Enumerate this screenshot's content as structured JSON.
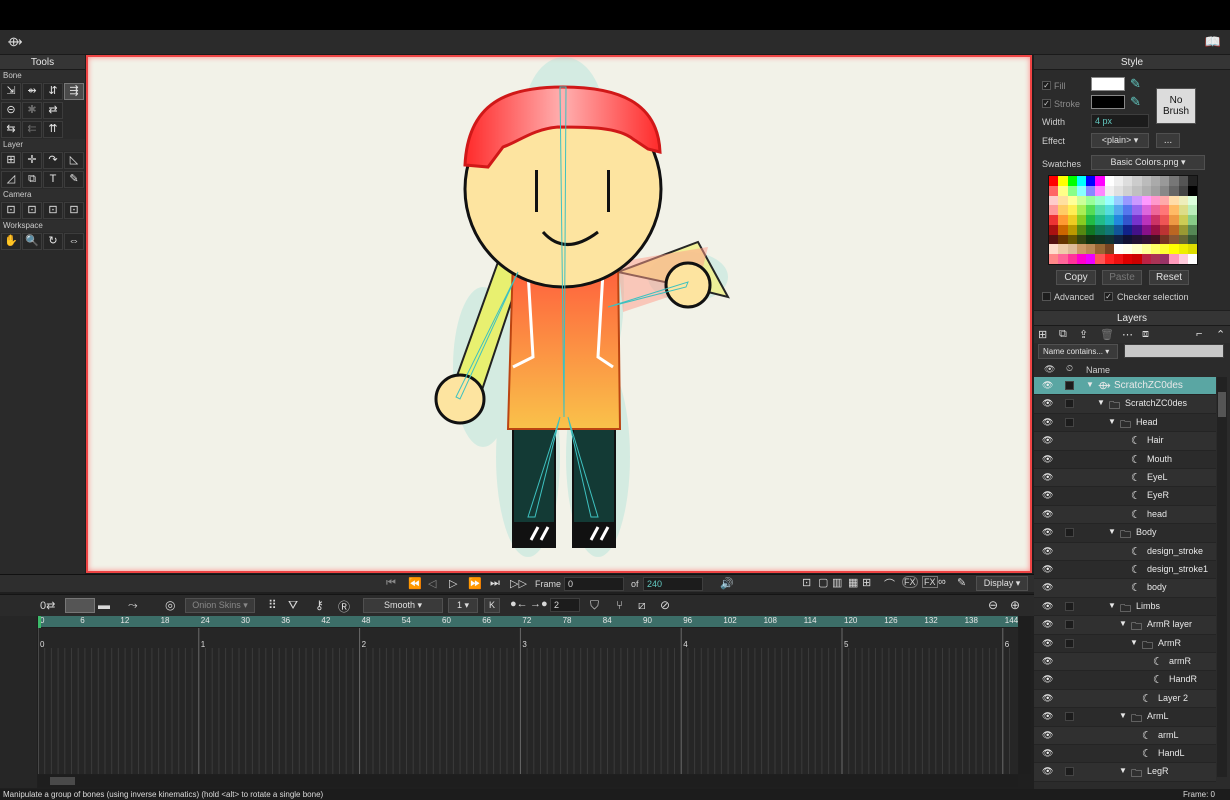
{
  "menubar": {
    "left_icon": "bone-tool-icon",
    "right_icon": "book-icon"
  },
  "tools": {
    "title": "Tools",
    "sections": [
      {
        "label": "Bone",
        "rows": [
          [
            "⇲",
            "⇴",
            "⇵",
            "⇶"
          ],
          [
            "⊝",
            "✱",
            "⇄"
          ],
          [
            "⇆",
            "⇇",
            "⇈"
          ]
        ]
      },
      {
        "label": "Layer",
        "rows": [
          [
            "⊞",
            "✛",
            "↷",
            "◺"
          ],
          [
            "◿",
            "⧉",
            "T",
            "✎"
          ]
        ]
      },
      {
        "label": "Camera",
        "rows": [
          [
            "⊡",
            "⊡",
            "⊡",
            "⊡"
          ]
        ]
      },
      {
        "label": "Workspace",
        "rows": [
          [
            "✋",
            "🔍",
            "↻",
            "⇔"
          ]
        ]
      }
    ]
  },
  "style": {
    "title": "Style",
    "fill_label": "Fill",
    "stroke_label": "Stroke",
    "fill_color": "#ffffff",
    "stroke_color": "#000000",
    "width_label": "Width",
    "width_value": "4 px",
    "effect_label": "Effect",
    "effect_value": "<plain>",
    "effect_more": "...",
    "no_brush": "No Brush",
    "swatches_label": "Swatches",
    "swatches_file": "Basic Colors.png",
    "copy": "Copy",
    "paste": "Paste",
    "reset": "Reset",
    "advanced": "Advanced",
    "checker": "Checker selection"
  },
  "layers": {
    "title": "Layers",
    "filter": "Name contains...",
    "name_header": "Name",
    "rows": [
      {
        "name": "ScratchZC0des",
        "indent": 0,
        "type": "bone",
        "expanded": true,
        "selected": true
      },
      {
        "name": "ScratchZC0des",
        "indent": 1,
        "type": "folder",
        "expanded": true
      },
      {
        "name": "Head",
        "indent": 2,
        "type": "folder",
        "expanded": true
      },
      {
        "name": "Hair",
        "indent": 3,
        "type": "vector"
      },
      {
        "name": "Mouth",
        "indent": 3,
        "type": "vector"
      },
      {
        "name": "EyeL",
        "indent": 3,
        "type": "vector"
      },
      {
        "name": "EyeR",
        "indent": 3,
        "type": "vector"
      },
      {
        "name": "head",
        "indent": 3,
        "type": "vector"
      },
      {
        "name": "Body",
        "indent": 2,
        "type": "folder",
        "expanded": true
      },
      {
        "name": "design_stroke",
        "indent": 3,
        "type": "vector"
      },
      {
        "name": "design_stroke1",
        "indent": 3,
        "type": "vector"
      },
      {
        "name": "body",
        "indent": 3,
        "type": "vector"
      },
      {
        "name": "Limbs",
        "indent": 2,
        "type": "folder",
        "expanded": true
      },
      {
        "name": "ArmR layer",
        "indent": 3,
        "type": "folder",
        "expanded": true
      },
      {
        "name": "ArmR",
        "indent": 4,
        "type": "folder",
        "expanded": true
      },
      {
        "name": "armR",
        "indent": 5,
        "type": "vector"
      },
      {
        "name": "HandR",
        "indent": 5,
        "type": "vector"
      },
      {
        "name": "Layer 2",
        "indent": 4,
        "type": "vector"
      },
      {
        "name": "ArmL",
        "indent": 3,
        "type": "folder",
        "expanded": true
      },
      {
        "name": "armL",
        "indent": 4,
        "type": "vector"
      },
      {
        "name": "HandL",
        "indent": 4,
        "type": "vector"
      },
      {
        "name": "LegR",
        "indent": 3,
        "type": "folder",
        "expanded": true
      }
    ]
  },
  "transport": {
    "frame_label": "Frame",
    "frame_value": "0",
    "of_label": "of",
    "total_frames": "240",
    "display": "Display"
  },
  "timeline": {
    "onion_skins": "Onion Skins",
    "interp": "Smooth",
    "interp_count": "1",
    "step": "2",
    "ruler": [
      "0",
      "6",
      "12",
      "18",
      "24",
      "30",
      "36",
      "42",
      "48",
      "54",
      "60",
      "66",
      "72",
      "78",
      "84",
      "90",
      "96",
      "102",
      "108",
      "114",
      "120",
      "126",
      "132",
      "138",
      "144"
    ],
    "seconds": [
      "0",
      "1",
      "2",
      "3",
      "4",
      "5",
      "6"
    ]
  },
  "status": {
    "message": "Manipulate a group of bones (using inverse kinematics) (hold <alt> to rotate a single bone)",
    "frame": "Frame: 0"
  }
}
